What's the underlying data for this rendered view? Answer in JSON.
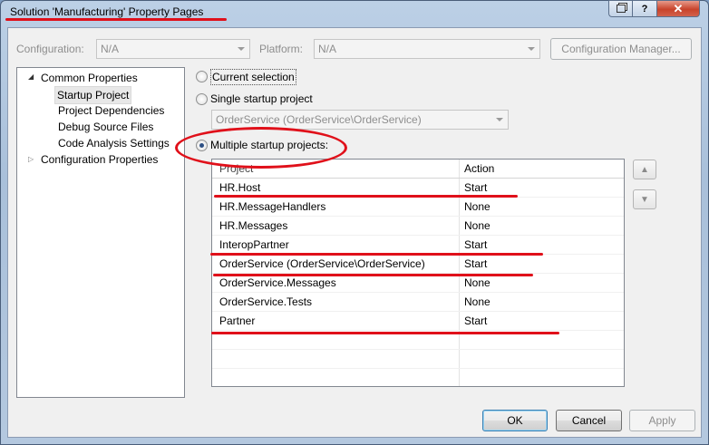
{
  "window": {
    "title": "Solution 'Manufacturing' Property Pages"
  },
  "toolbar": {
    "configuration_label": "Configuration:",
    "configuration_value": "N/A",
    "platform_label": "Platform:",
    "platform_value": "N/A",
    "config_manager_label": "Configuration Manager..."
  },
  "tree": {
    "root_label": "Common Properties",
    "children": [
      "Startup Project",
      "Project Dependencies",
      "Debug Source Files",
      "Code Analysis Settings"
    ],
    "config_label": "Configuration Properties"
  },
  "startup": {
    "current_selection_label": "Current selection",
    "single_label": "Single startup project",
    "single_value": "OrderService (OrderService\\OrderService)",
    "multiple_label": "Multiple startup projects:",
    "selected_option": "multiple"
  },
  "grid": {
    "headers": [
      "Project",
      "Action"
    ],
    "rows": [
      {
        "project": "HR.Host",
        "action": "Start"
      },
      {
        "project": "HR.MessageHandlers",
        "action": "None"
      },
      {
        "project": "HR.Messages",
        "action": "None"
      },
      {
        "project": "InteropPartner",
        "action": "Start"
      },
      {
        "project": "OrderService (OrderService\\OrderService)",
        "action": "Start"
      },
      {
        "project": "OrderService.Messages",
        "action": "None"
      },
      {
        "project": "OrderService.Tests",
        "action": "None"
      },
      {
        "project": "Partner",
        "action": "Start"
      }
    ]
  },
  "footer": {
    "ok_label": "OK",
    "cancel_label": "Cancel",
    "apply_label": "Apply"
  },
  "colors": {
    "annotation": "#e0101a",
    "selection": "#2d4f84"
  }
}
